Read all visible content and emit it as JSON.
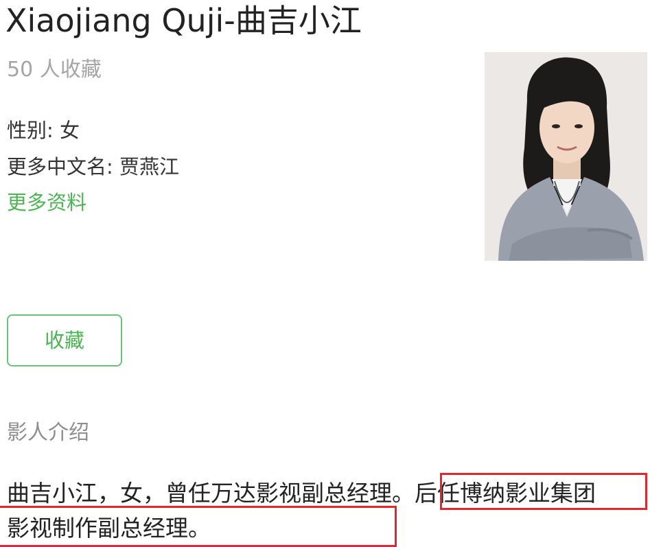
{
  "profile": {
    "name": "Xiaojiang Quji-曲吉小江",
    "favorites_count": "50 人收藏",
    "gender": "性别: 女",
    "alias": "更多中文名: 贾燕江",
    "more_info_link": "更多资料",
    "photo_icon": "portrait-photo"
  },
  "actions": {
    "favorite_label": "收藏"
  },
  "bio": {
    "heading": "影人介绍",
    "line1_part1": "曲吉小江，女，曾任万达影视副总经理。",
    "line1_part2": "后任博纳影业集团",
    "line2": "影视制作副总经理。"
  },
  "colors": {
    "accent_green": "#4db453",
    "highlight_red": "#e22730"
  }
}
